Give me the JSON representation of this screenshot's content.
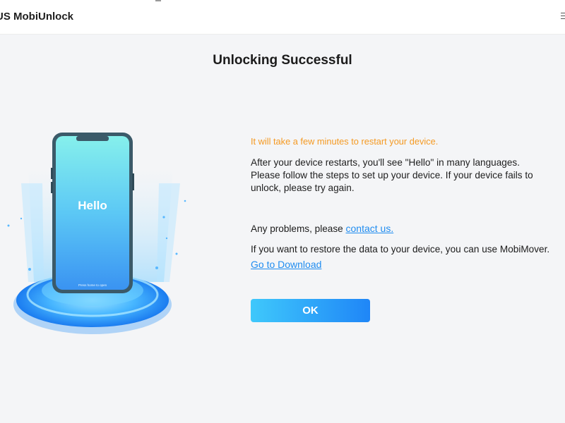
{
  "window": {
    "app_title": "US MobiUnlock",
    "menu_icon": "hamburger-menu-icon"
  },
  "main": {
    "heading": "Unlocking Successful",
    "phone_screen": {
      "greeting": "Hello",
      "footer": "Press home to open"
    },
    "warning": "It will take a few minutes to restart your device.",
    "instructions": "After your device restarts, you'll see \"Hello\" in many languages. Please follow the steps to set up your device. If your device fails to unlock, please try again.",
    "problems_text": "Any problems, please ",
    "contact_link": "contact us.",
    "restore_text": "If you want to restore the data to your device, you can use MobiMover.",
    "download_link": "Go to Download",
    "ok_button": "OK"
  },
  "colors": {
    "accent_blue": "#1f8cf0",
    "warning_orange": "#f59a23",
    "button_gradient_start": "#3fc8fb",
    "button_gradient_end": "#1f86f7"
  }
}
